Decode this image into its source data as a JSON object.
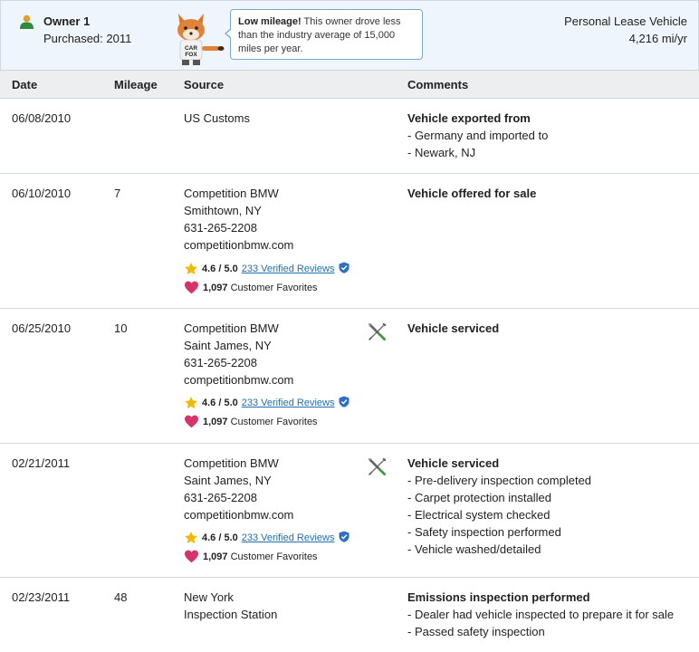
{
  "owner": {
    "title": "Owner 1",
    "purchased": "Purchased: 2011",
    "callout_bold": "Low mileage!",
    "callout_text": " This owner drove less than the industry average of 15,000 miles per year.",
    "vehicle_type": "Personal Lease Vehicle",
    "miles_per_year": "4,216 mi/yr",
    "mascot_badge": "CAR FOX"
  },
  "columns": {
    "date": "Date",
    "mileage": "Mileage",
    "source": "Source",
    "comments": "Comments"
  },
  "rating": {
    "score": "4.6 / 5.0",
    "reviews_link": "233 Verified Reviews",
    "favorites_count": "1,097",
    "favorites_label": " Customer Favorites"
  },
  "records": [
    {
      "date": "06/08/2010",
      "mileage": "",
      "source": [
        "US Customs"
      ],
      "comment_title": "Vehicle exported from",
      "comment_items": [
        "- Germany and imported to",
        "- Newark, NJ"
      ]
    },
    {
      "date": "06/10/2010",
      "mileage": "7",
      "source": [
        "Competition BMW",
        "Smithtown, NY",
        "631-265-2208",
        "competitionbmw.com"
      ],
      "comment_title": "Vehicle offered for sale",
      "comment_items": []
    },
    {
      "date": "06/25/2010",
      "mileage": "10",
      "source": [
        "Competition BMW",
        "Saint James, NY",
        "631-265-2208",
        "competitionbmw.com"
      ],
      "comment_title": "Vehicle serviced",
      "comment_items": []
    },
    {
      "date": "02/21/2011",
      "mileage": "",
      "source": [
        "Competition BMW",
        "Saint James, NY",
        "631-265-2208",
        "competitionbmw.com"
      ],
      "comment_title": "Vehicle serviced",
      "comment_items": [
        "- Pre-delivery inspection completed",
        "- Carpet protection installed",
        "- Electrical system checked",
        "- Safety inspection performed",
        "- Vehicle washed/detailed"
      ]
    },
    {
      "date": "02/23/2011",
      "mileage": "48",
      "source": [
        "New York",
        "Inspection Station"
      ],
      "comment_title": "Emissions inspection performed",
      "comment_items": [
        "- Dealer had vehicle inspected to prepare it for sale",
        "- Passed safety inspection"
      ]
    }
  ],
  "colors": {
    "header_bg": "#eef5fc",
    "link_blue": "#1f6fb2",
    "star_gold": "#f5b800",
    "heart_pink": "#d6336c",
    "owner_icon_green": "#2e8b3a"
  },
  "icons": {
    "owner": "person-icon",
    "rating": "star-icon",
    "verified": "shield-check-icon",
    "favorites": "heart-icon",
    "service": "wrench-screwdriver-icon"
  }
}
